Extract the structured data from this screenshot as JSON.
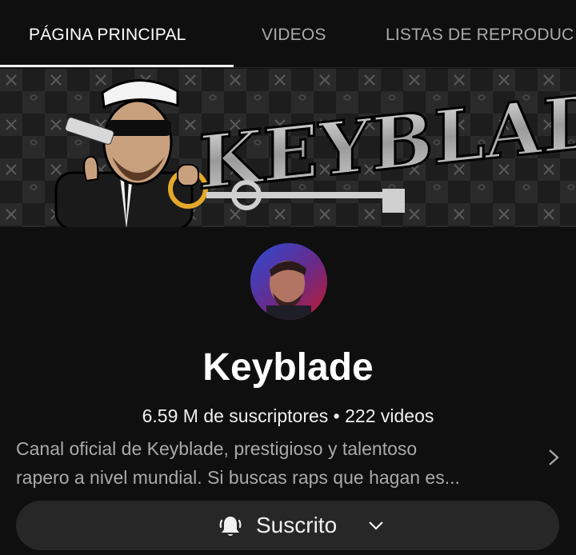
{
  "tabs": [
    {
      "label": "PÁGINA PRINCIPAL",
      "active": true
    },
    {
      "label": "VIDEOS",
      "active": false
    },
    {
      "label": "LISTAS DE REPRODUC",
      "active": false
    }
  ],
  "banner": {
    "logo_text": "KEYBLADE"
  },
  "channel": {
    "name": "Keyblade",
    "stats": "6.59 M de suscriptores • 222 videos",
    "description_line1": "Canal oficial de Keyblade, prestigioso y talentoso",
    "description_line2": "rapero a nivel mundial. Si buscas raps que hagan es..."
  },
  "subscribe": {
    "label": "Suscrito"
  },
  "icons": {
    "bell": "bell-ring-icon",
    "chevron_down": "chevron-down-icon",
    "chevron_right": "chevron-right-icon"
  },
  "colors": {
    "background": "#0f0f0f",
    "button_bg": "#272727",
    "text_primary": "#f1f1f1",
    "text_secondary": "#aaaaaa"
  }
}
